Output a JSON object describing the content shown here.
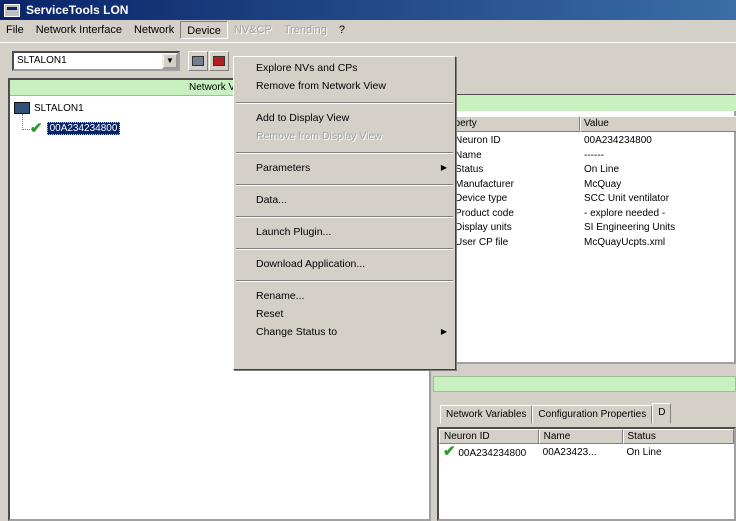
{
  "window": {
    "title": "ServiceTools LON"
  },
  "menubar": [
    {
      "label": "File",
      "state": "normal"
    },
    {
      "label": "Network Interface",
      "state": "normal"
    },
    {
      "label": "Network",
      "state": "normal"
    },
    {
      "label": "Device",
      "state": "active"
    },
    {
      "label": "NV&CP",
      "state": "disabled"
    },
    {
      "label": "Trending",
      "state": "disabled"
    },
    {
      "label": "?",
      "state": "normal"
    }
  ],
  "toolbar": {
    "combo_value": "SLTALON1"
  },
  "left_pane": {
    "header": "Network View",
    "root_label": "SLTALON1",
    "child_label": "00A234234800"
  },
  "properties": {
    "headers": [
      "Property",
      "Value"
    ],
    "rows": [
      {
        "k": "Neuron ID",
        "v": "00A234234800"
      },
      {
        "k": "Name",
        "v": "------"
      },
      {
        "k": "Status",
        "v": "On Line"
      },
      {
        "k": "Manufacturer",
        "v": "McQuay"
      },
      {
        "k": "Device type",
        "v": "SCC Unit ventilator"
      },
      {
        "k": "Product code",
        "v": "- explore needed -"
      },
      {
        "k": "Display units",
        "v": "SI Engineering Units"
      },
      {
        "k": "User CP file",
        "v": "McQuayUcpts.xml"
      }
    ]
  },
  "bottom": {
    "tabs": [
      "Network Variables",
      "Configuration Properties",
      "D"
    ],
    "columns": [
      "Neuron ID",
      "Name",
      "Status"
    ],
    "rows": [
      {
        "id": "00A234234800",
        "name": "00A23423...",
        "status": "On Line"
      }
    ]
  },
  "device_menu": [
    {
      "label": "Explore NVs and CPs",
      "disabled": false
    },
    {
      "label": "Remove from Network View",
      "disabled": false
    },
    {
      "sep": true
    },
    {
      "label": "Add to Display View",
      "disabled": false
    },
    {
      "label": "Remove from Display View",
      "disabled": true
    },
    {
      "sep": true
    },
    {
      "label": "Parameters",
      "disabled": false,
      "submenu": true
    },
    {
      "sep": true
    },
    {
      "label": "Data...",
      "disabled": false
    },
    {
      "sep": true
    },
    {
      "label": "Launch Plugin...",
      "disabled": false
    },
    {
      "sep": true
    },
    {
      "label": "Download Application...",
      "disabled": false
    },
    {
      "sep": true
    },
    {
      "label": "Rename...",
      "disabled": false
    },
    {
      "label": "Reset",
      "disabled": false
    },
    {
      "label": "Change Status to",
      "disabled": false,
      "submenu": true
    }
  ]
}
